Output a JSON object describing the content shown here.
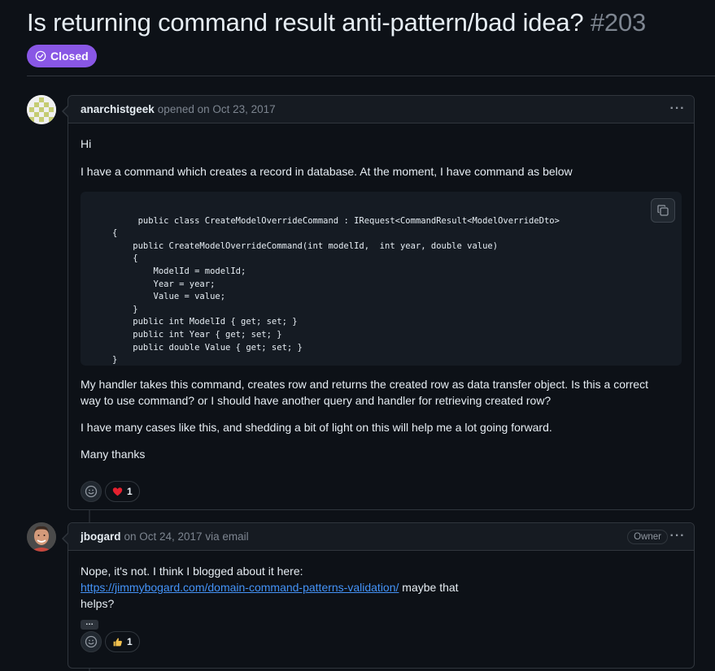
{
  "issue": {
    "title": "Is returning command result anti-pattern/bad idea?",
    "number": "#203",
    "state": "Closed"
  },
  "comments": [
    {
      "author": "anarchistgeek",
      "meta": "opened on Oct 23, 2017",
      "paragraphs": {
        "p1": "Hi",
        "p2": "I have a command which creates a record in database. At the moment, I have command as below",
        "p3": "My handler takes this command, creates row and returns the created row as data transfer object. Is this a correct way to use command? or I should have another query and handler for retrieving created row?",
        "p4": "I have many cases like this, and shedding a bit of light on this will help me a lot going forward.",
        "p5": "Many thanks"
      },
      "code": "public class CreateModelOverrideCommand : IRequest<CommandResult<ModelOverrideDto>\n   {\n       public CreateModelOverrideCommand(int modelId,  int year, double value)\n       {\n           ModelId = modelId;\n           Year = year;\n           Value = value;\n       }\n       public int ModelId { get; set; }\n       public int Year { get; set; }\n       public double Value { get; set; }\n   }",
      "reaction": {
        "icon": "heart",
        "count": "1"
      }
    },
    {
      "author": "jbogard",
      "meta": "on Oct 24, 2017 via email",
      "badge": "Owner",
      "text_before": "Nope, it's not. I think I blogged about it here:",
      "link": "https://jimmybogard.com/domain-command-patterns-validation/",
      "text_after": " maybe that",
      "text_after2": "helps?",
      "hidden_text_button": "…",
      "reaction": {
        "icon": "thumbs-up",
        "count": "1"
      }
    }
  ],
  "colors": {
    "background": "#0d1117",
    "closed_badge": "#8957e5",
    "link": "#4493f8",
    "border": "#30363d"
  }
}
